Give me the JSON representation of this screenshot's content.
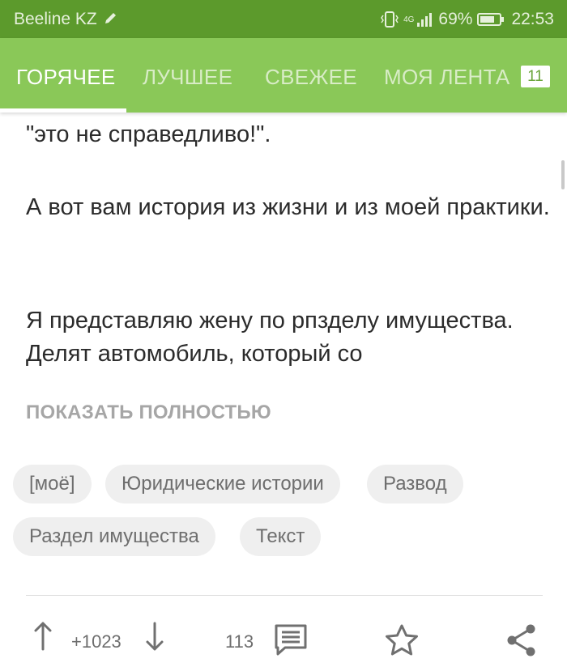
{
  "status_bar": {
    "carrier": "Beeline KZ",
    "network": "4G",
    "battery": "69%",
    "time": "22:53"
  },
  "tabs": {
    "items": [
      {
        "label": "ГОРЯЧЕЕ",
        "active": true
      },
      {
        "label": "ЛУЧШЕЕ",
        "active": false
      },
      {
        "label": "СВЕЖЕЕ",
        "active": false
      },
      {
        "label": "МОЯ ЛЕНТА",
        "active": false
      }
    ],
    "feed_badge": "11"
  },
  "post": {
    "paragraphs": [
      "\"это не справедливо!\".",
      "А вот вам история из жизни и из моей практики.",
      "Я представляю жену по рпзделу имущества. Делят автомобиль, который со"
    ],
    "show_more": "ПОКАЗАТЬ ПОЛНОСТЬЮ",
    "tags": [
      "[моё]",
      "Юридические истории",
      "Развод",
      "Раздел имущества",
      "Текст"
    ],
    "rating": "+1023",
    "comments": "113"
  },
  "icons": {
    "upvote": "arrow-up-icon",
    "downvote": "arrow-down-icon",
    "comments": "comment-icon",
    "favorite": "star-icon",
    "share": "share-icon"
  },
  "colors": {
    "brand_green": "#8ac858",
    "status_green": "#5c9a2c"
  }
}
